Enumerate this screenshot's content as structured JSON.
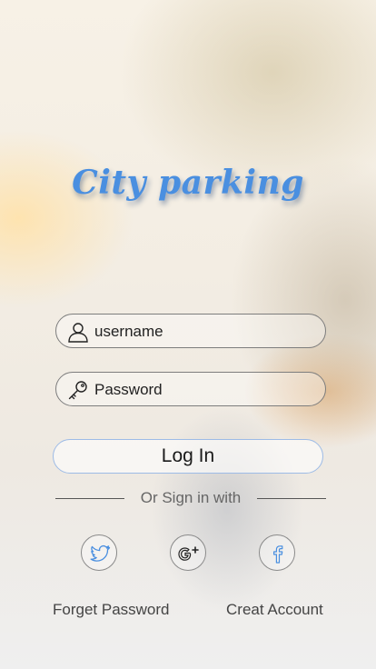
{
  "app": {
    "title": "City parking"
  },
  "form": {
    "username_placeholder": "username",
    "password_placeholder": "Password",
    "login_label": "Log In"
  },
  "social": {
    "divider_text": "Or Sign in with",
    "buttons": [
      {
        "name": "twitter",
        "icon": "twitter-icon"
      },
      {
        "name": "google-plus",
        "icon": "google-plus-icon"
      },
      {
        "name": "facebook",
        "icon": "facebook-icon"
      }
    ]
  },
  "links": {
    "forgot_password": "Forget Password",
    "create_account": "Creat Account"
  },
  "colors": {
    "accent": "#4a8fe0",
    "login_border": "#9dbbe6"
  }
}
